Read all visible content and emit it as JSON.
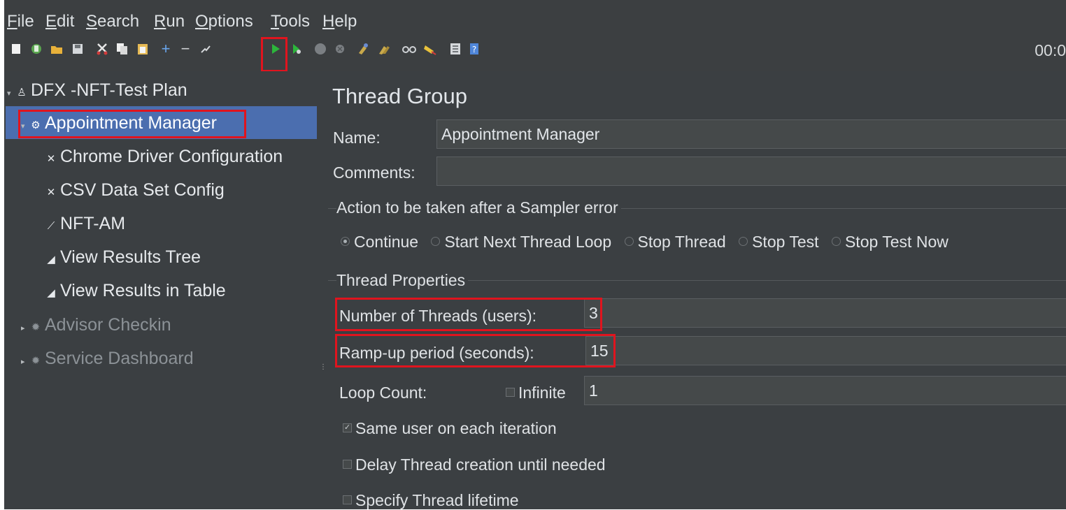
{
  "menu": {
    "items": [
      {
        "key": "F",
        "rest": "ile"
      },
      {
        "key": "E",
        "rest": "dit"
      },
      {
        "key": "S",
        "rest": "earch"
      },
      {
        "key": "R",
        "rest": "un"
      },
      {
        "key": "O",
        "rest": "ptions"
      },
      {
        "key": "T",
        "rest": "ools"
      },
      {
        "key": "H",
        "rest": "elp"
      }
    ]
  },
  "toolbar": {
    "timer": "00:0",
    "icons": [
      "new-icon",
      "templates-icon",
      "open-icon",
      "save-icon",
      "cut-icon",
      "copy-icon",
      "paste-icon",
      "expand-icon",
      "collapse-icon",
      "toggle-icon",
      "start-icon",
      "start-no-pauses-icon",
      "stop-icon",
      "shutdown-icon",
      "clear-icon",
      "clear-all-icon",
      "search-icon",
      "reset-search-icon",
      "function-helper-icon",
      "help-icon"
    ]
  },
  "tree": {
    "root": "DFX -NFT-Test Plan",
    "selected": "Appointment Manager",
    "children": [
      "Chrome Driver Configuration",
      "CSV Data Set Config",
      "NFT-AM",
      "View Results Tree",
      "View Results in Table"
    ],
    "others": [
      "Advisor Checkin",
      "Service Dashboard"
    ]
  },
  "panel": {
    "title": "Thread Group",
    "name_label": "Name:",
    "name_value": "Appointment Manager",
    "comments_label": "Comments:",
    "comments_value": "",
    "error_group": "Action to be taken after a Sampler error",
    "error_options": [
      "Continue",
      "Start Next Thread Loop",
      "Stop Thread",
      "Stop Test",
      "Stop Test Now"
    ],
    "error_selected": "Continue",
    "props_group": "Thread Properties",
    "threads_label": "Number of Threads (users):",
    "threads_value": "3",
    "rampup_label": "Ramp-up period (seconds):",
    "rampup_value": "15",
    "loop_label": "Loop Count:",
    "infinite_label": "Infinite",
    "infinite_checked": false,
    "loop_value": "1",
    "same_user_label": "Same user on each iteration",
    "same_user_checked": true,
    "delay_label": "Delay Thread creation until needed",
    "delay_checked": false,
    "lifetime_label": "Specify Thread lifetime",
    "lifetime_checked": false
  },
  "colors": {
    "background": "#3b3f42",
    "selection": "#4b6eaf",
    "highlight": "#e0141e"
  }
}
